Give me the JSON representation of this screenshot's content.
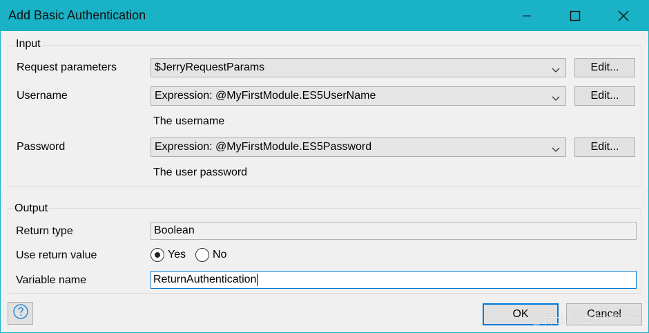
{
  "window": {
    "title": "Add Basic Authentication",
    "accent_color": "#1ab2c7",
    "controls": [
      "minimize-icon",
      "maximize-icon",
      "close-icon"
    ]
  },
  "input_group": {
    "title": "Input",
    "request_parameters": {
      "label": "Request parameters",
      "value": "$JerryRequestParams",
      "edit_label": "Edit..."
    },
    "username": {
      "label": "Username",
      "value": "Expression: @MyFirstModule.ES5UserName",
      "edit_label": "Edit...",
      "hint": "The username"
    },
    "password": {
      "label": "Password",
      "value": "Expression: @MyFirstModule.ES5Password",
      "edit_label": "Edit...",
      "hint": "The user password"
    }
  },
  "output_group": {
    "title": "Output",
    "return_type": {
      "label": "Return type",
      "value": "Boolean"
    },
    "use_return_value": {
      "label": "Use return value",
      "options": [
        "Yes",
        "No"
      ],
      "selected": "Yes"
    },
    "variable_name": {
      "label": "Variable name",
      "value": "ReturnAuthentication"
    }
  },
  "footer": {
    "help_icon": "question-circle-icon",
    "ok_label": "OK",
    "cancel_label": "Cancel"
  },
  "watermark": "@稀土掘金技术社区"
}
